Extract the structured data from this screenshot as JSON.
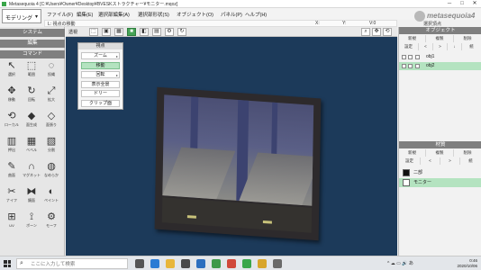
{
  "window": {
    "title": "Metasequoia 4 [C:¥Users¥Owner¥Desktop¥BVESKストラクチャー¥モニター.mqoz]",
    "minimize": "─",
    "maximize": "□",
    "close": "✕"
  },
  "mode_select": {
    "value": "モデリング",
    "chevron": "▾"
  },
  "menu": [
    "ファイル(F)",
    "編集(E)",
    "選択部編集(A)",
    "選択部形状(S)",
    "オブジェクト(O)",
    "パネル(P)",
    "ヘルプ(H)"
  ],
  "logo": {
    "text": "metasequoia4"
  },
  "infobar": {
    "text": "L: 視点の移動",
    "x": "X:",
    "y": "Y:",
    "z": "V:0"
  },
  "right_info": {
    "label": "選択頂点"
  },
  "left_panel": {
    "system": "システム",
    "edit": "編集",
    "command": "コマンド",
    "tools": [
      {
        "icon": "arrow-select-icon",
        "glyph": "↖",
        "label": "選択"
      },
      {
        "icon": "rect-select-icon",
        "glyph": "⬚",
        "label": "範囲"
      },
      {
        "icon": "lasso-icon",
        "glyph": "◌",
        "label": "投縄"
      },
      {
        "icon": "move-icon",
        "glyph": "✥",
        "label": "移動"
      },
      {
        "icon": "rotate-icon",
        "glyph": "↻",
        "label": "回転"
      },
      {
        "icon": "scale-icon",
        "glyph": "⤢",
        "label": "拡大"
      },
      {
        "icon": "transform-icon",
        "glyph": "⟲",
        "label": "ローカル"
      },
      {
        "icon": "face-icon",
        "glyph": "◆",
        "label": "面生成"
      },
      {
        "icon": "knife-icon",
        "glyph": "◇",
        "label": "面張り"
      },
      {
        "icon": "extrude-icon",
        "glyph": "▥",
        "label": "押出"
      },
      {
        "icon": "bevel-icon",
        "glyph": "▦",
        "label": "ベベル"
      },
      {
        "icon": "sculpt-icon",
        "glyph": "▧",
        "label": "分割"
      },
      {
        "icon": "brush-icon",
        "glyph": "✎",
        "label": "曲面"
      },
      {
        "icon": "magnet-icon",
        "glyph": "∩",
        "label": "マグネット"
      },
      {
        "icon": "smooth-icon",
        "glyph": "◍",
        "label": "なめらか"
      },
      {
        "icon": "weld-icon",
        "glyph": "✂",
        "label": "ナイフ"
      },
      {
        "icon": "mirror-icon",
        "glyph": "⧓",
        "label": "鏡面"
      },
      {
        "icon": "paint-icon",
        "glyph": "◐",
        "label": "ペイント"
      },
      {
        "icon": "uv-icon",
        "glyph": "⊞",
        "label": "UV"
      },
      {
        "icon": "bone-icon",
        "glyph": "⟟",
        "label": "ボーン"
      },
      {
        "icon": "morph-icon",
        "glyph": "⚙",
        "label": "モーフ"
      }
    ]
  },
  "view_toolbar": {
    "label": "透視"
  },
  "popup": {
    "title": "視点",
    "items": [
      {
        "label": "ズーム",
        "selected": false,
        "submenu": true
      },
      {
        "label": "移動",
        "selected": true,
        "submenu": false
      },
      {
        "label": "回転",
        "selected": false,
        "submenu": true
      },
      {
        "label": "表示全景",
        "selected": false,
        "submenu": false
      },
      {
        "label": "ドリー",
        "selected": false,
        "submenu": false
      },
      {
        "label": "クリップ面",
        "selected": false,
        "submenu": false
      }
    ]
  },
  "object_panel": {
    "title": "オブジェクト",
    "buttons": [
      "新規",
      "複製",
      "削除"
    ],
    "buttons2": [
      "設定",
      "<",
      ">",
      "↓",
      "統"
    ],
    "objects": [
      {
        "name": "obj1",
        "selected": false
      },
      {
        "name": "obj2",
        "selected": true
      }
    ]
  },
  "material_panel": {
    "title": "材質",
    "buttons": [
      "新規",
      "複製",
      "削除"
    ],
    "buttons2": [
      "設定",
      "<",
      ">",
      "統"
    ],
    "materials": [
      {
        "name": "二部",
        "color": "#111111",
        "selected": false
      },
      {
        "name": "モニター",
        "color": "#ffffff",
        "selected": true
      }
    ]
  },
  "taskbar": {
    "search_placeholder": "ここに入力して検索",
    "apps": [
      {
        "icon": "task-view-icon",
        "color": "#555555"
      },
      {
        "icon": "edge-icon",
        "color": "#2a7bd4"
      },
      {
        "icon": "explorer-icon",
        "color": "#e8b63a"
      },
      {
        "icon": "store-icon",
        "color": "#4a4a4a"
      },
      {
        "icon": "mail-icon",
        "color": "#2c6fbf"
      },
      {
        "icon": "chrome-icon",
        "color": "#3f9a4a"
      },
      {
        "icon": "app-icon",
        "color": "#d0473a"
      },
      {
        "icon": "metasequoia-icon",
        "color": "#3aa64a"
      },
      {
        "icon": "folder-icon",
        "color": "#d8a52b"
      },
      {
        "icon": "settings-icon",
        "color": "#6a6a6a"
      }
    ],
    "tray_text": "^ ☁ ▭ 🔊 あ",
    "time": "0:46",
    "date": "2020/10/06"
  },
  "colors": {
    "viewport_bg": "#1c3a5a",
    "accent_green": "#46a357",
    "selection_green": "#b4e3c0",
    "panel_header": "#7f7f7f"
  }
}
